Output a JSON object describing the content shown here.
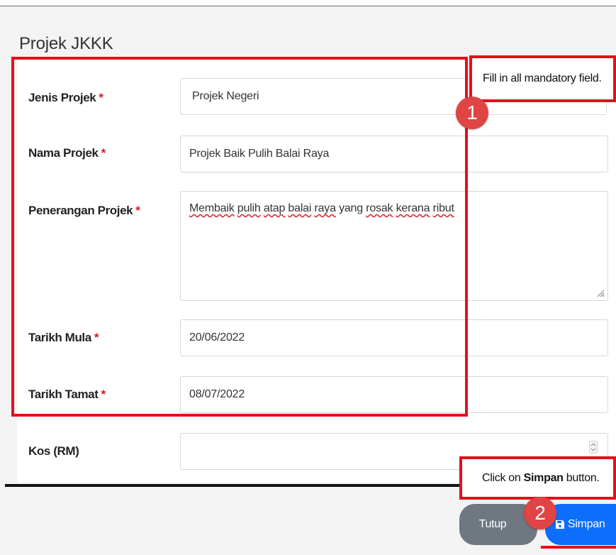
{
  "modal": {
    "title": "Projek JKKK"
  },
  "form": {
    "required_mark": "*",
    "jenis_projek": {
      "label": "Jenis Projek",
      "value": "Projek Negeri"
    },
    "nama_projek": {
      "label": "Nama Projek",
      "value": "Projek Baik Pulih Balai Raya"
    },
    "penerangan_projek": {
      "label": "Penerangan Projek",
      "value_words": [
        "Membaik",
        "pulih",
        "atap",
        "balai",
        "raya",
        "yang",
        "rosak",
        "kerana",
        "ribut"
      ]
    },
    "tarikh_mula": {
      "label": "Tarikh Mula",
      "value": "20/06/2022"
    },
    "tarikh_tamat": {
      "label": "Tarikh Tamat",
      "value": "08/07/2022"
    },
    "kos": {
      "label": "Kos (RM)",
      "value": ""
    }
  },
  "annotations": {
    "step1": {
      "number": "1",
      "text": "Fill in all mandatory field."
    },
    "step2": {
      "number": "2",
      "prefix": "Click on ",
      "bold": "Simpan",
      "suffix": " button."
    }
  },
  "footer": {
    "tutup_label": "Tutup",
    "simpan_label": "Simpan"
  },
  "colors": {
    "highlight": "#e3101a",
    "badge": "#e04444",
    "primary": "#0d6efd",
    "secondary": "#6f7780",
    "required": "#d9161c"
  },
  "icons": {
    "simpan": "floppy-disk-icon",
    "resize": "resize-grip-icon",
    "spinner": "number-spinner-icon"
  }
}
